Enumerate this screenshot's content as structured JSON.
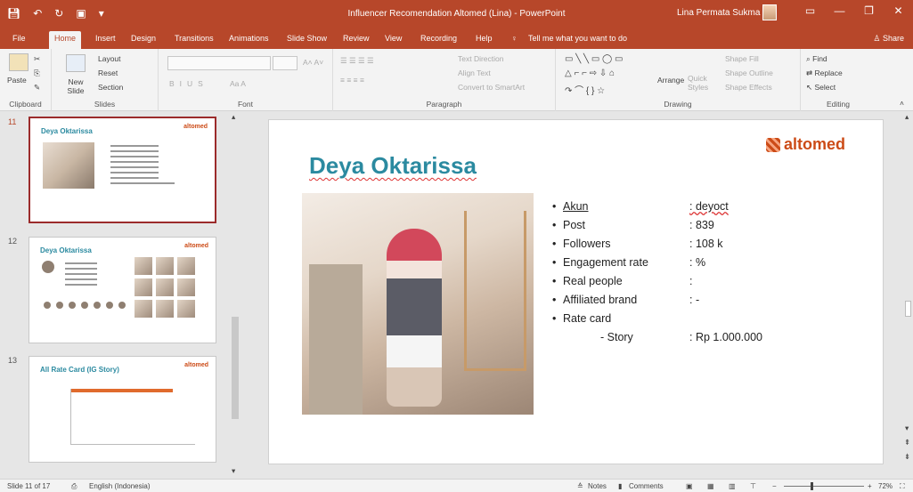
{
  "window": {
    "title": "Influencer Recomendation Altomed (Lina)  -  PowerPoint",
    "user": "Lina Permata Sukma",
    "controls": [
      "—",
      "❐",
      "✕"
    ]
  },
  "ribbon_tabs": [
    "File",
    "Home",
    "Insert",
    "Design",
    "Transitions",
    "Animations",
    "Slide Show",
    "Review",
    "View",
    "Recording",
    "Help"
  ],
  "tell_me": "Tell me what you want to do",
  "share": "Share",
  "ribbon": {
    "clipboard": {
      "paste": "Paste",
      "label": "Clipboard"
    },
    "slides": {
      "layout": "Layout",
      "reset": "Reset",
      "new_slide": "New Slide",
      "section": "Section",
      "label": "Slides"
    },
    "font": {
      "label": "Font"
    },
    "paragraph": {
      "text_direction": "Text Direction",
      "align_text": "Align Text",
      "convert_smartart": "Convert to SmartArt",
      "label": "Paragraph"
    },
    "drawing": {
      "arrange": "Arrange",
      "quick_styles": "Quick Styles",
      "shape_fill": "Shape Fill",
      "shape_outline": "Shape Outline",
      "shape_effects": "Shape Effects",
      "label": "Drawing"
    },
    "editing": {
      "find": "Find",
      "replace": "Replace",
      "select": "Select",
      "label": "Editing"
    }
  },
  "thumbnails": [
    {
      "number": "11",
      "title": "Deya Oktarissa",
      "logo": "altomed"
    },
    {
      "number": "12",
      "title": "Deya Oktarissa",
      "logo": "altomed"
    },
    {
      "number": "13",
      "title": "All Rate Card (IG Story)",
      "logo": "altomed"
    }
  ],
  "slide": {
    "title": "Deya Oktarissa",
    "logo": "altomed",
    "rows": [
      {
        "label": "Akun",
        "value": ": deyoct"
      },
      {
        "label": "Post",
        "value": ": 839"
      },
      {
        "label": "Followers",
        "value": ": 108 k"
      },
      {
        "label": "Engagement rate",
        "value": ": %"
      },
      {
        "label": "Real people",
        "value": ":"
      },
      {
        "label": "Affiliated brand",
        "value": ": -"
      },
      {
        "label": "Rate card",
        "value": ""
      },
      {
        "label": "- Story",
        "value": ": Rp 1.000.000"
      }
    ]
  },
  "status": {
    "slide_count": "Slide 11 of 17",
    "language": "English (Indonesia)",
    "notes": "Notes",
    "comments": "Comments",
    "zoom": "72%",
    "zoom_level": 0.72
  }
}
